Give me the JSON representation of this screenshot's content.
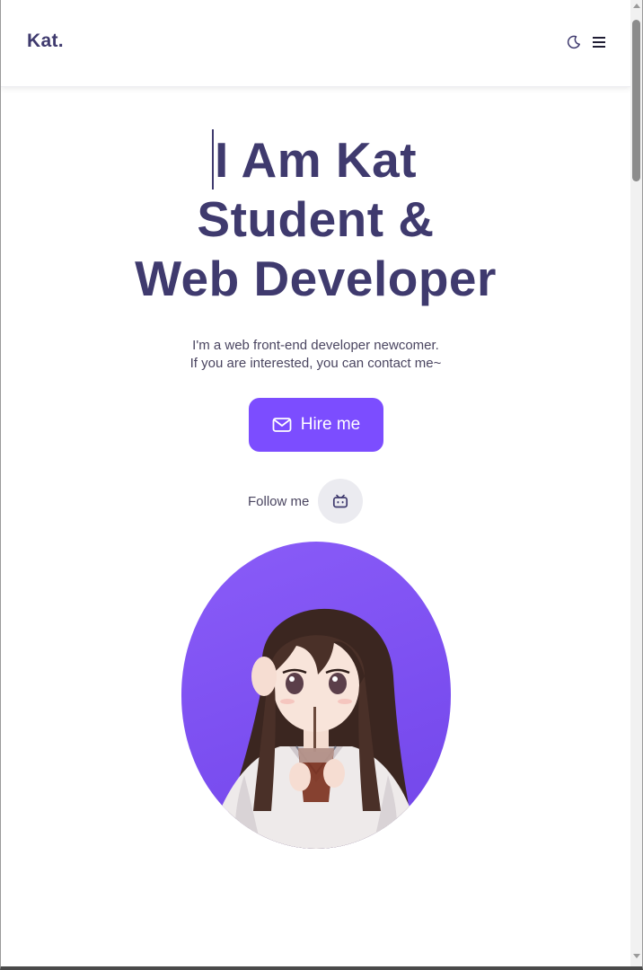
{
  "header": {
    "logo": "Kat.",
    "theme_toggle_icon": "moon-icon",
    "menu_icon": "hamburger-menu-icon"
  },
  "hero": {
    "title_line1": "I Am Kat",
    "title_line2": "Student &",
    "title_line3": "Web Developer",
    "subtitle_line1": "I'm a web front-end developer newcomer.",
    "subtitle_line2": "If you are interested, you can contact me~",
    "hire_button": {
      "label": "Hire me",
      "icon": "mail-icon"
    },
    "follow_label": "Follow me",
    "social_icon": "bilibili-icon"
  },
  "colors": {
    "primary": "#7c4dff",
    "heading": "#3f3a6e",
    "text": "#4a4560",
    "social_bg": "#ebebf0"
  }
}
